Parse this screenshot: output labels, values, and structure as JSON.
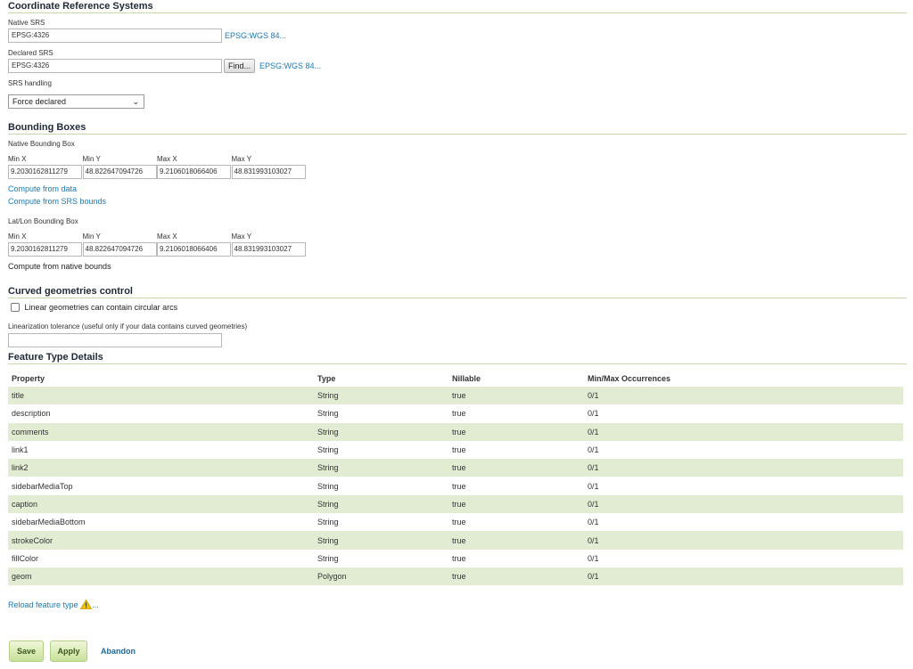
{
  "crs": {
    "section_title": "Coordinate Reference Systems",
    "native_srs_label": "Native SRS",
    "native_srs_value": "EPSG:4326",
    "native_srs_link": "EPSG:WGS 84...",
    "declared_srs_label": "Declared SRS",
    "declared_srs_value": "EPSG:4326",
    "find_button": "Find...",
    "declared_srs_link": "EPSG:WGS 84...",
    "srs_handling_label": "SRS handling",
    "srs_handling_value": "Force declared"
  },
  "bbox": {
    "section_title": "Bounding Boxes",
    "native_label": "Native Bounding Box",
    "latlon_label": "Lat/Lon Bounding Box",
    "headers": [
      "Min X",
      "Min Y",
      "Max X",
      "Max Y"
    ],
    "native_values": [
      "9.2030162811279",
      "48.822647094726",
      "9.2106018066406",
      "48.831993103027"
    ],
    "latlon_values": [
      "9.2030162811279",
      "48.822647094726",
      "9.2106018066406",
      "48.831993103027"
    ],
    "compute_from_data": "Compute from data",
    "compute_from_srs": "Compute from SRS bounds",
    "compute_from_native": "Compute from native bounds"
  },
  "curved": {
    "section_title": "Curved geometries control",
    "checkbox_label": "Linear geometries can contain circular arcs",
    "tolerance_label": "Linearization tolerance (useful only if your data contains curved geometries)",
    "tolerance_value": ""
  },
  "feature_type": {
    "section_title": "Feature Type Details",
    "columns": [
      "Property",
      "Type",
      "Nillable",
      "Min/Max Occurrences"
    ],
    "rows": [
      [
        "title",
        "String",
        "true",
        "0/1"
      ],
      [
        "description",
        "String",
        "true",
        "0/1"
      ],
      [
        "comments",
        "String",
        "true",
        "0/1"
      ],
      [
        "link1",
        "String",
        "true",
        "0/1"
      ],
      [
        "link2",
        "String",
        "true",
        "0/1"
      ],
      [
        "sidebarMediaTop",
        "String",
        "true",
        "0/1"
      ],
      [
        "caption",
        "String",
        "true",
        "0/1"
      ],
      [
        "sidebarMediaBottom",
        "String",
        "true",
        "0/1"
      ],
      [
        "strokeColor",
        "String",
        "true",
        "0/1"
      ],
      [
        "fillColor",
        "String",
        "true",
        "0/1"
      ],
      [
        "geom",
        "Polygon",
        "true",
        "0/1"
      ]
    ],
    "reload_link": "Reload feature type",
    "reload_suffix": "..."
  },
  "actions": {
    "save": "Save",
    "apply": "Apply",
    "abandon": "Abandon"
  },
  "colors": {
    "row_stripe": "#e1ecd3",
    "link": "#1a7ab8",
    "section_rule": "#c9d8a8",
    "button_green": "#c8e09a",
    "warning": "#f2c200"
  },
  "icons": {
    "warning": "warning-icon",
    "select_chevron": "chevron-down-icon"
  }
}
